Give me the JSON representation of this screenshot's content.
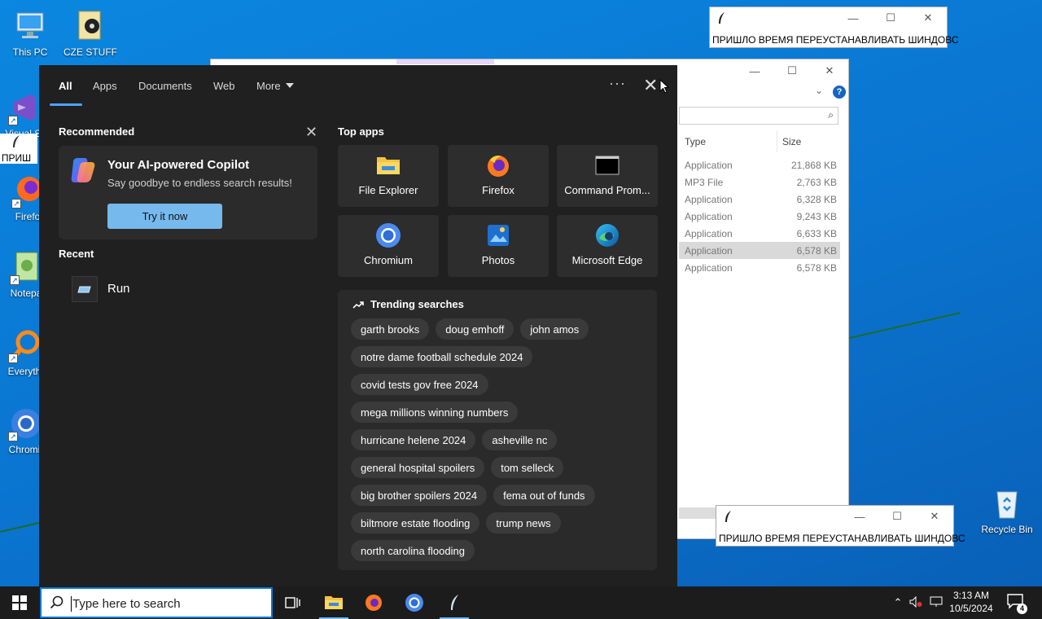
{
  "desktop": {
    "icons": [
      {
        "label": "This PC"
      },
      {
        "label": "CZE STUFF"
      },
      {
        "label": "Visual St"
      },
      {
        "label": "ПРИШ"
      },
      {
        "label": "Firefo"
      },
      {
        "label": "Notepa"
      },
      {
        "label": "Everyth"
      },
      {
        "label": "Chromi"
      },
      {
        "label": "Recycle Bin"
      }
    ]
  },
  "notepad_windows": [
    {
      "text": "ПРИШЛО ВРЕМЯ ПЕРЕУСТАНАВЛИВАТЬ ШИНДОВС"
    },
    {
      "text": "ПРИШЛО ВРЕМЯ ПЕРЕУСТАНАВЛИВАТЬ ШИНДОВС"
    }
  ],
  "explorer": {
    "columns": {
      "type": "Type",
      "size": "Size"
    },
    "rows": [
      {
        "type": "Application",
        "size": "21,868 KB"
      },
      {
        "type": "MP3 File",
        "size": "2,763 KB"
      },
      {
        "type": "Application",
        "size": "6,328 KB"
      },
      {
        "type": "Application",
        "size": "9,243 KB"
      },
      {
        "type": "Application",
        "size": "6,633 KB"
      },
      {
        "type": "Application",
        "size": "6,578 KB"
      },
      {
        "type": "Application",
        "size": "6,578 KB"
      }
    ]
  },
  "search_panel": {
    "tabs": {
      "all": "All",
      "apps": "Apps",
      "documents": "Documents",
      "web": "Web",
      "more": "More"
    },
    "more_dots": "···",
    "recommended": {
      "title": "Recommended",
      "copilot_title": "Your AI-powered Copilot",
      "copilot_subtitle": "Say goodbye to endless search results!",
      "try_label": "Try it now"
    },
    "recent": {
      "title": "Recent",
      "items": [
        {
          "label": "Run"
        }
      ]
    },
    "top_apps": {
      "title": "Top apps",
      "apps": [
        {
          "label": "File Explorer",
          "icon": "file-explorer-icon"
        },
        {
          "label": "Firefox",
          "icon": "firefox-icon"
        },
        {
          "label": "Command Prom...",
          "icon": "command-prompt-icon"
        },
        {
          "label": "Chromium",
          "icon": "chromium-icon"
        },
        {
          "label": "Photos",
          "icon": "photos-icon"
        },
        {
          "label": "Microsoft Edge",
          "icon": "edge-icon"
        }
      ]
    },
    "trending": {
      "title": "Trending searches",
      "chips": [
        "garth brooks",
        "doug emhoff",
        "john amos",
        "notre dame football schedule 2024",
        "covid tests gov free 2024",
        "mega millions winning numbers",
        "hurricane helene 2024",
        "asheville nc",
        "general hospital spoilers",
        "tom selleck",
        "big brother spoilers 2024",
        "fema out of funds",
        "biltmore estate flooding",
        "trump news",
        "north carolina flooding"
      ]
    }
  },
  "taskbar": {
    "search_placeholder": "Type here to search",
    "time": "3:13 AM",
    "date": "10/5/2024",
    "notification_count": "4"
  },
  "colors": {
    "desktop": "#0a78d6",
    "panel": "#202020",
    "accent": "#76b9ed"
  }
}
